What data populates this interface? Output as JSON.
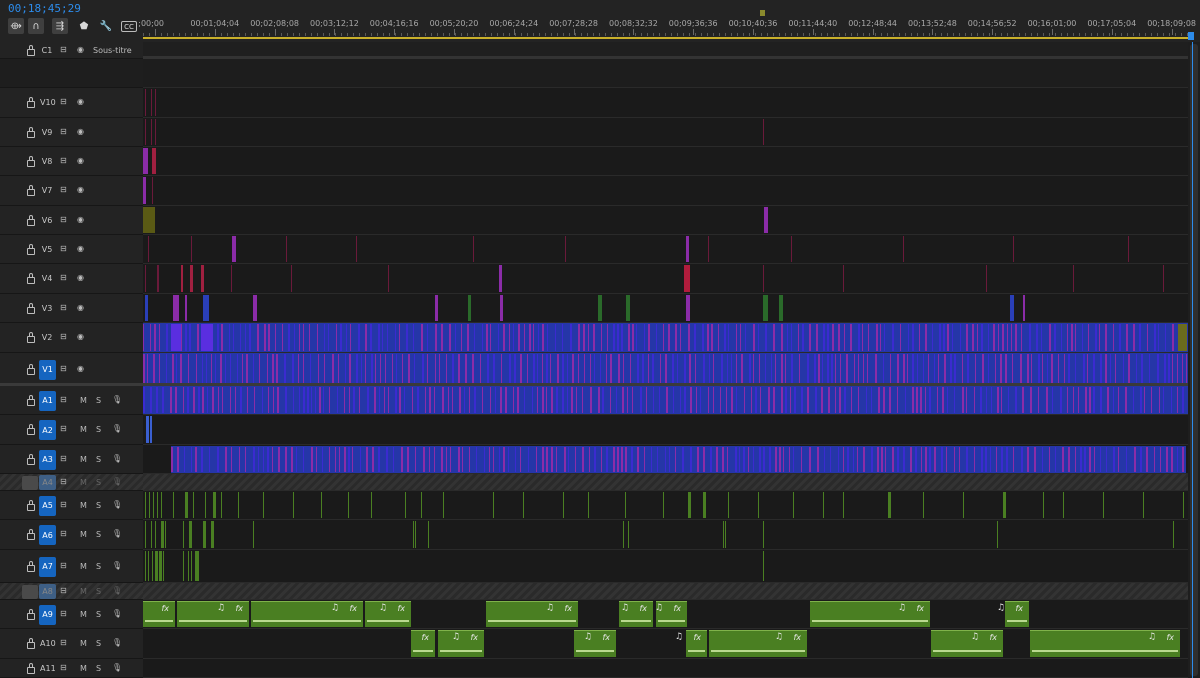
{
  "timecode": "00;18;45;29",
  "toolbar": [
    {
      "name": "insert-nest-icon",
      "glyph": "⟴",
      "boxed": true
    },
    {
      "name": "snap-magnet-icon",
      "glyph": "∩",
      "boxed": true
    },
    {
      "name": "linked-selection-icon",
      "glyph": "⇶",
      "boxed": true
    },
    {
      "name": "add-marker-icon",
      "glyph": "⬟",
      "boxed": false
    },
    {
      "name": "wrench-settings-icon",
      "glyph": "🔧",
      "boxed": false
    },
    {
      "name": "captions-icon",
      "glyph": "CC",
      "boxed": false
    }
  ],
  "ruler_labels": [
    ";00;00",
    "00;01;04;04",
    "00;02;08;08",
    "00;03;12;12",
    "00;04;16;16",
    "00;05;20;20",
    "00;06;24;24",
    "00;07;28;28",
    "00;08;32;32",
    "00;09;36;36",
    "00;10;40;36",
    "00;11;44;40",
    "00;12;48;44",
    "00;13;52;48",
    "00;14;56;52",
    "00;16;01;00",
    "00;17;05;04",
    "00;18;09;08"
  ],
  "caption_track": {
    "name": "C1",
    "label": "Sous-titre"
  },
  "video_tracks": [
    {
      "name": "V10",
      "source": false
    },
    {
      "name": "V9",
      "source": false
    },
    {
      "name": "V8",
      "source": false
    },
    {
      "name": "V7",
      "source": false
    },
    {
      "name": "V6",
      "source": false
    },
    {
      "name": "V5",
      "source": false
    },
    {
      "name": "V4",
      "source": false
    },
    {
      "name": "V3",
      "source": false
    },
    {
      "name": "V2",
      "source": false
    },
    {
      "name": "V1",
      "source": true
    }
  ],
  "audio_tracks": [
    {
      "name": "A1",
      "m": "M",
      "s": "S",
      "source": true
    },
    {
      "name": "A2",
      "m": "M",
      "s": "S",
      "source": true
    },
    {
      "name": "A3",
      "m": "M",
      "s": "S",
      "source": true
    },
    {
      "name": "A4",
      "m": "M",
      "s": "S",
      "source": true,
      "locked": true
    },
    {
      "name": "A5",
      "m": "M",
      "s": "S",
      "source": true
    },
    {
      "name": "A6",
      "m": "M",
      "s": "S",
      "source": true
    },
    {
      "name": "A7",
      "m": "M",
      "s": "S",
      "source": true
    },
    {
      "name": "A8",
      "m": "M",
      "s": "S",
      "source": true,
      "locked": true
    },
    {
      "name": "A9",
      "m": "M",
      "s": "S",
      "source": true
    },
    {
      "name": "A10",
      "m": "M",
      "s": "S",
      "source": false
    },
    {
      "name": "A11",
      "m": "M",
      "s": "S",
      "source": false
    }
  ],
  "clip_labels": {
    "fx": "fx",
    "music": "♫"
  },
  "colors": {
    "accent": "#2d8ceb",
    "source_patch": "#1565c0",
    "video_clip_blue": "#2a3fb8",
    "video_clip_purple": "#8b2ca8",
    "audio_clip": "#4a7f22",
    "work_area": "#c9b02b"
  }
}
